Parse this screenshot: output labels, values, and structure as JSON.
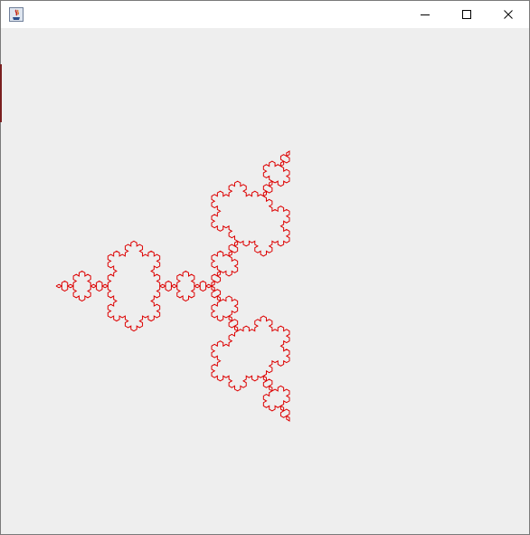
{
  "window": {
    "title": "",
    "icon": "java-coffee-cup-icon",
    "controls": {
      "minimize_icon": "minimize-icon",
      "maximize_icon": "maximize-icon",
      "close_icon": "close-icon"
    }
  },
  "canvas": {
    "background": "#eeeeee",
    "figure": "koch-snowflake",
    "recursion_depth": 4,
    "stroke_color": "#dd0000"
  }
}
